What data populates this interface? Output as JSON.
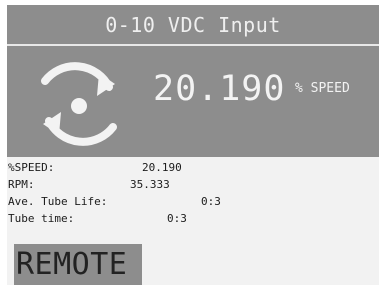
{
  "header": {
    "title": "0-10 VDC Input"
  },
  "main": {
    "icon": "rotation-arrows-icon",
    "speed_value": "20.190",
    "speed_unit": "% SPEED"
  },
  "stats": [
    {
      "label": "%SPEED:",
      "value": "20.190"
    },
    {
      "label": "RPM:",
      "value": "35.333"
    },
    {
      "label": "Ave. Tube Life:",
      "value": "0:3"
    },
    {
      "label": "Tube time:",
      "value": "0:3"
    }
  ],
  "footer": {
    "mode": "REMOTE"
  },
  "colors": {
    "panel": "#8d8d8d",
    "background": "#f2f2f2",
    "text_light": "#f3f3f3",
    "text_dark": "#1c1c1c"
  }
}
